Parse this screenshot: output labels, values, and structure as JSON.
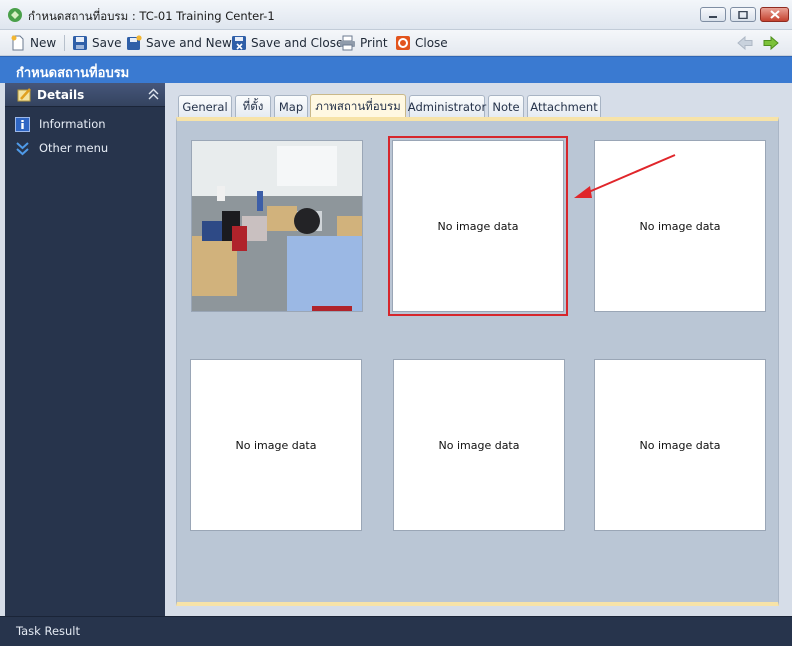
{
  "window": {
    "title": "กำหนดสถานที่อบรม : TC-01 Training Center-1"
  },
  "toolbar": {
    "new_label": "New",
    "save_label": "Save",
    "save_new_label": "Save and New",
    "save_close_label": "Save and Close",
    "print_label": "Print",
    "close_label": "Close"
  },
  "header": {
    "title": "กำหนดสถานที่อบรม"
  },
  "sidebar": {
    "title": "Details",
    "items": [
      {
        "label": "Information",
        "icon": "info-icon"
      },
      {
        "label": "Other menu",
        "icon": "double-chevron-down-icon"
      }
    ]
  },
  "tabs": [
    {
      "label": "General"
    },
    {
      "label": "ที่ตั้ง"
    },
    {
      "label": "Map"
    },
    {
      "label": "ภาพสถานที่อบรม",
      "active": true
    },
    {
      "label": "Administrator"
    },
    {
      "label": "Note"
    },
    {
      "label": "Attachment"
    }
  ],
  "images": [
    {
      "type": "photo",
      "caption": ""
    },
    {
      "type": "empty",
      "caption": "No image data"
    },
    {
      "type": "empty",
      "caption": "No image data"
    },
    {
      "type": "empty",
      "caption": "No image data"
    },
    {
      "type": "empty",
      "caption": "No image data"
    },
    {
      "type": "empty",
      "caption": "No image data"
    }
  ],
  "status": {
    "text": "Task Result"
  },
  "colors": {
    "header_blue": "#3a7ad1",
    "sidebar_dark": "#27344c",
    "highlight_red": "#d6262c",
    "tab_accent": "#f7e3a8"
  }
}
